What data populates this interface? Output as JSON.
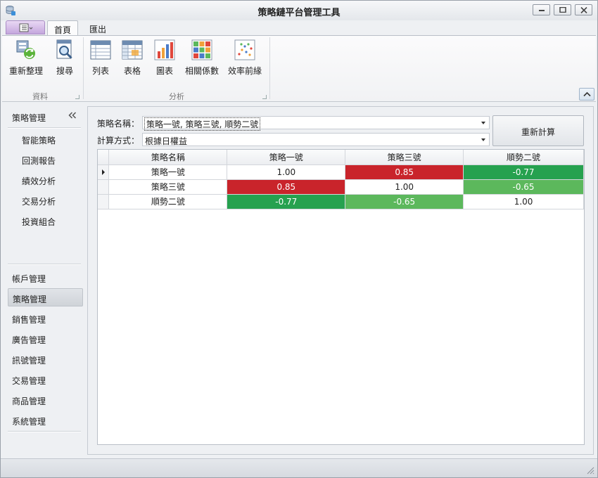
{
  "window": {
    "title": "策略鏈平台管理工具"
  },
  "ribbon": {
    "tabs": [
      {
        "label": "首頁",
        "active": true
      },
      {
        "label": "匯出",
        "active": false
      }
    ],
    "groups": {
      "data": {
        "label": "資料",
        "buttons": [
          {
            "label": "重新整理",
            "icon": "refresh-icon"
          },
          {
            "label": "搜尋",
            "icon": "search-icon"
          }
        ]
      },
      "analysis": {
        "label": "分析",
        "buttons": [
          {
            "label": "列表",
            "icon": "list-icon"
          },
          {
            "label": "表格",
            "icon": "table-icon"
          },
          {
            "label": "圖表",
            "icon": "bar-chart-icon"
          },
          {
            "label": "相關係數",
            "icon": "heatmap-icon"
          },
          {
            "label": "效率前緣",
            "icon": "scatter-icon"
          }
        ]
      }
    }
  },
  "nav": {
    "header": "策略管理",
    "sub_items": [
      "智能策略",
      "回測報告",
      "績效分析",
      "交易分析",
      "投資組合"
    ],
    "groups": [
      {
        "label": "帳戶管理",
        "selected": false
      },
      {
        "label": "策略管理",
        "selected": true
      },
      {
        "label": "銷售管理",
        "selected": false
      },
      {
        "label": "廣告管理",
        "selected": false
      },
      {
        "label": "訊號管理",
        "selected": false
      },
      {
        "label": "交易管理",
        "selected": false
      },
      {
        "label": "商品管理",
        "selected": false
      },
      {
        "label": "系統管理",
        "selected": false
      }
    ]
  },
  "form": {
    "strategy_label": "策略名稱：",
    "strategy_value": "策略一號, 策略三號, 順勢二號",
    "method_label": "計算方式：",
    "method_value": "根據日權益",
    "recalc_button": "重新計算"
  },
  "grid": {
    "columns": [
      "策略名稱",
      "策略一號",
      "策略三號",
      "順勢二號"
    ],
    "rows": [
      {
        "name": "策略一號",
        "values": [
          "1.00",
          "0.85",
          "-0.77"
        ]
      },
      {
        "name": "策略三號",
        "values": [
          "0.85",
          "1.00",
          "-0.65"
        ]
      },
      {
        "name": "順勢二號",
        "values": [
          "-0.77",
          "-0.65",
          "1.00"
        ]
      }
    ],
    "cell_colors": {
      "diagonal": "#ffffff",
      "strong_positive": "#c9242b",
      "strong_negative": "#26a14f",
      "moderate_negative": "#5cb85c"
    }
  }
}
